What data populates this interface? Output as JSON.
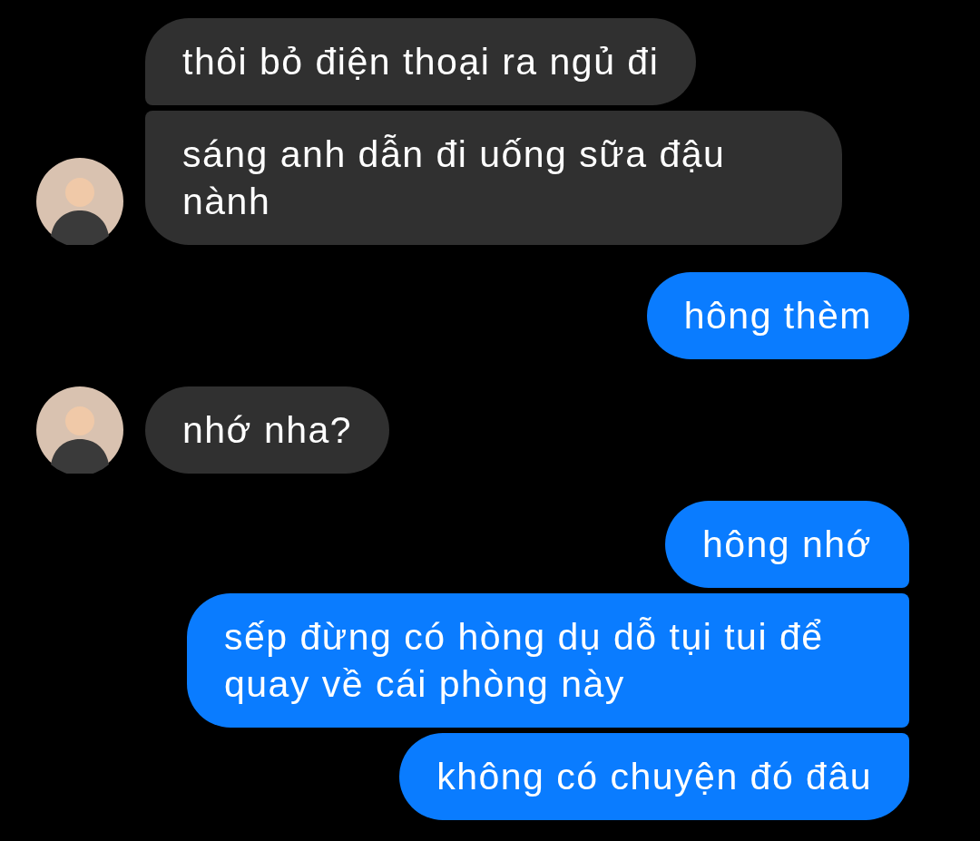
{
  "messages": [
    {
      "kind": "incoming",
      "text": "thôi bỏ điện thoại ra ngủ đi",
      "show_avatar": false
    },
    {
      "kind": "incoming",
      "text": "sáng anh dẫn đi uống sữa đậu nành",
      "show_avatar": true
    },
    {
      "kind": "outgoing",
      "text": "hông thèm",
      "show_avatar": false
    },
    {
      "kind": "incoming",
      "text": "nhớ nha?",
      "show_avatar": true
    },
    {
      "kind": "outgoing",
      "text": "hông nhớ",
      "show_avatar": false
    },
    {
      "kind": "outgoing",
      "text": "sếp đừng có hòng dụ dỗ tụi tui để quay về cái phòng này",
      "show_avatar": false
    },
    {
      "kind": "outgoing",
      "text": "không có chuyện đó đâu",
      "show_avatar": false
    }
  ]
}
